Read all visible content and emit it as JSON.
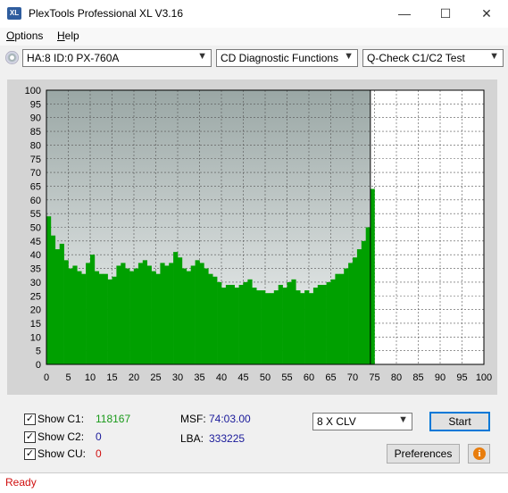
{
  "window": {
    "title": "PlexTools Professional XL V3.16",
    "app_icon_text": "XL",
    "minimize_glyph": "—",
    "maximize_glyph": "☐",
    "close_glyph": "✕"
  },
  "menu": [
    {
      "label": "Options",
      "mnemonic": "O",
      "rest": "ptions"
    },
    {
      "label": "Help",
      "mnemonic": "H",
      "rest": "elp"
    }
  ],
  "selectors": {
    "drive": "HA:8 ID:0  PX-760A",
    "function": "CD Diagnostic Functions",
    "test": "Q-Check C1/C2 Test"
  },
  "chart_data": {
    "type": "bar",
    "title": "",
    "xlabel": "",
    "ylabel": "",
    "xlim": [
      0,
      100
    ],
    "ylim": [
      0,
      100
    ],
    "x_ticks": [
      0,
      5,
      10,
      15,
      20,
      25,
      30,
      35,
      40,
      45,
      50,
      55,
      60,
      65,
      70,
      75,
      80,
      85,
      90,
      95,
      100
    ],
    "y_ticks": [
      0,
      5,
      10,
      15,
      20,
      25,
      30,
      35,
      40,
      45,
      50,
      55,
      60,
      65,
      70,
      75,
      80,
      85,
      90,
      95,
      100
    ],
    "grid": true,
    "marker_x": 74.05,
    "series": [
      {
        "color": "#00a000",
        "x_step": 1,
        "values": [
          54,
          47,
          42,
          44,
          38,
          35,
          36,
          34,
          33,
          37,
          40,
          34,
          33,
          33,
          31,
          32,
          36,
          37,
          35,
          34,
          35,
          37,
          38,
          36,
          34,
          33,
          37,
          36,
          37,
          41,
          39,
          35,
          34,
          36,
          38,
          37,
          35,
          33,
          32,
          30,
          28,
          29,
          29,
          28,
          29,
          30,
          31,
          28,
          27,
          27,
          26,
          26,
          27,
          29,
          28,
          30,
          31,
          27,
          26,
          27,
          26,
          28,
          29,
          29,
          30,
          31,
          33,
          33,
          35,
          37,
          39,
          42,
          45,
          50,
          64
        ]
      }
    ],
    "colors": {
      "plot_background_top": "#9aa7a5",
      "plot_background_bottom": "#f4f6f6",
      "unused_background": "#ffffff",
      "panel": "#d4d4d4"
    }
  },
  "stats": {
    "c1_label": "Show C1:",
    "c1_value": "118167",
    "c2_label": "Show C2:",
    "c2_value": "0",
    "cu_label": "Show CU:",
    "cu_value": "0",
    "c1_checked": true,
    "c2_checked": true,
    "cu_checked": true,
    "check_glyph": "✓",
    "msf_label": "MSF:",
    "msf_value": "74:03.00",
    "lba_label": "LBA:",
    "lba_value": "333225"
  },
  "controls": {
    "speed": "8 X CLV",
    "start_label": "Start",
    "preferences_label": "Preferences",
    "info_glyph": "i"
  },
  "status": {
    "text": "Ready"
  }
}
